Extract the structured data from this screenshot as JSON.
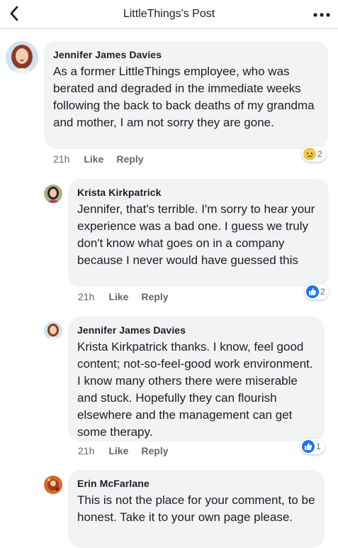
{
  "header": {
    "title": "LittleThings's Post"
  },
  "icons": {
    "back": "back-chevron-icon",
    "more": "more-options-icon",
    "like": "like-reaction-icon",
    "sad": "sad-reaction-icon"
  },
  "colors": {
    "bubble": "#f2f3f5",
    "like_blue": "#1877f2",
    "sad_yellow": "#f7c64a"
  },
  "comments": [
    {
      "author": "Jennifer James Davies",
      "text": "As a former LittleThings employee, who was berated and degraded in the immediate weeks following the back to back deaths of my grandma and mother, I am not sorry they are gone.",
      "time": "21h",
      "like": "Like",
      "reply": "Reply",
      "reaction": {
        "type": "sad",
        "count": "2"
      }
    },
    {
      "author": "Krista Kirkpatrick",
      "text": "Jennifer, that's terrible. I'm sorry to hear your experience was a bad one. I guess we truly don't know what goes on in a company because I never would have guessed this",
      "time": "21h",
      "like": "Like",
      "reply": "Reply",
      "reaction": {
        "type": "like",
        "count": "2"
      }
    },
    {
      "author": "Jennifer James Davies",
      "text": "Krista Kirkpatrick thanks. I know, feel good content; not-so-feel-good work environment. I know many others there were miserable and stuck. Hopefully they can flourish elsewhere and the management can get some therapy.",
      "time": "21h",
      "like": "Like",
      "reply": "Reply",
      "reaction": {
        "type": "like",
        "count": "1"
      }
    },
    {
      "author": "Erin McFarlane",
      "text": "This is not the place for your comment, to be honest. Take it to your own page please."
    }
  ]
}
